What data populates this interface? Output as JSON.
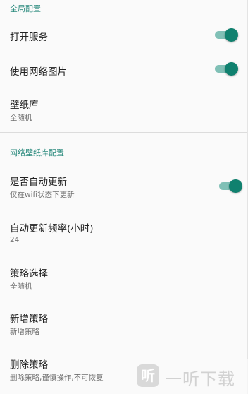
{
  "sections": {
    "global": {
      "header": "全局配置"
    },
    "wallpaper": {
      "header": "网络壁纸库配置"
    }
  },
  "items": {
    "start_service": {
      "title": "打开服务",
      "switch_on": true
    },
    "use_network_images": {
      "title": "使用网络图片",
      "switch_on": true
    },
    "wallpaper_library": {
      "title": "壁纸库",
      "summary": "全随机"
    },
    "auto_update": {
      "title": "是否自动更新",
      "summary": "仅在wifi状态下更新",
      "switch_on": true
    },
    "update_frequency": {
      "title": "自动更新频率(小时)",
      "summary": "24"
    },
    "strategy_select": {
      "title": "策略选择",
      "summary": "全随机"
    },
    "add_strategy": {
      "title": "新增策略",
      "summary": "新增策略"
    },
    "delete_strategy": {
      "title": "删除策略",
      "summary": "删除策略,谨慎操作,不可恢复"
    }
  },
  "watermark": {
    "logo_glyph": "听",
    "text": "一听下载"
  },
  "colors": {
    "accent": "#10816f",
    "accent_track": "#80c0b6",
    "section_header": "#2a8a7d"
  }
}
